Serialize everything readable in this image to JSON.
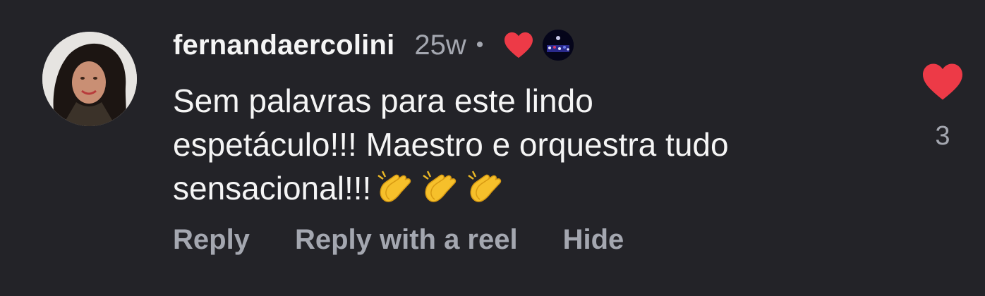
{
  "comment": {
    "username": "fernandaercolini",
    "timestamp": "25w",
    "separator": "•",
    "creator_liked_icon": "heart-icon",
    "text_line_1": "Sem palavras para este lindo",
    "text_line_2": "espetáculo!!! Maestro e orquestra tudo",
    "text_line_3": "sensacional!!!",
    "emoji": [
      "clapping-hands",
      "clapping-hands",
      "clapping-hands"
    ],
    "like_count": "3"
  },
  "actions": {
    "reply_label": "Reply",
    "reply_reel_label": "Reply with a reel",
    "hide_label": "Hide"
  },
  "colors": {
    "background": "#232328",
    "primary_text": "#f5f5f5",
    "secondary_text": "#a4a7b0",
    "heart_red": "#ed3a47"
  }
}
